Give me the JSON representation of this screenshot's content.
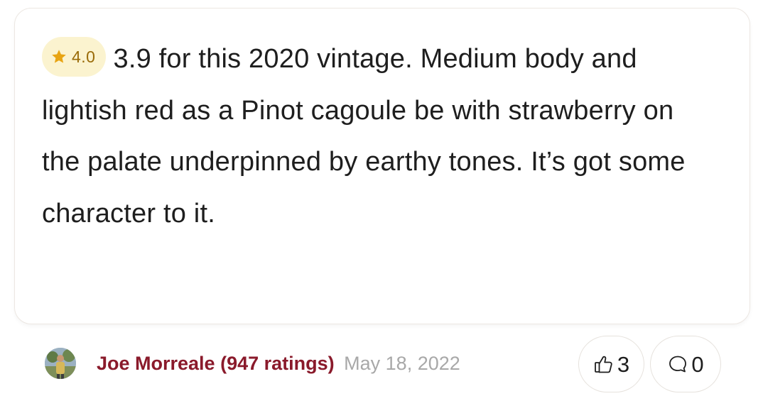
{
  "review": {
    "rating": "4.0",
    "text": "3.9 for this 2020 vintage. Medium body and lightish red as a Pinot cagoule be with strawberry on the palate underpinned by earthy tones. It’s got some character to it."
  },
  "author": {
    "name": "Joe Morreale (947 ratings)",
    "date": "May 18, 2022"
  },
  "actions": {
    "likes": "3",
    "comments": "0"
  },
  "colors": {
    "star": "#e8a412",
    "badge_bg": "#fbf3cf",
    "author": "#8a1a2b",
    "date": "#a8a8a8"
  },
  "icons": {
    "rating": "star-icon",
    "like": "thumbs-up-icon",
    "comment": "comment-bubble-icon"
  }
}
